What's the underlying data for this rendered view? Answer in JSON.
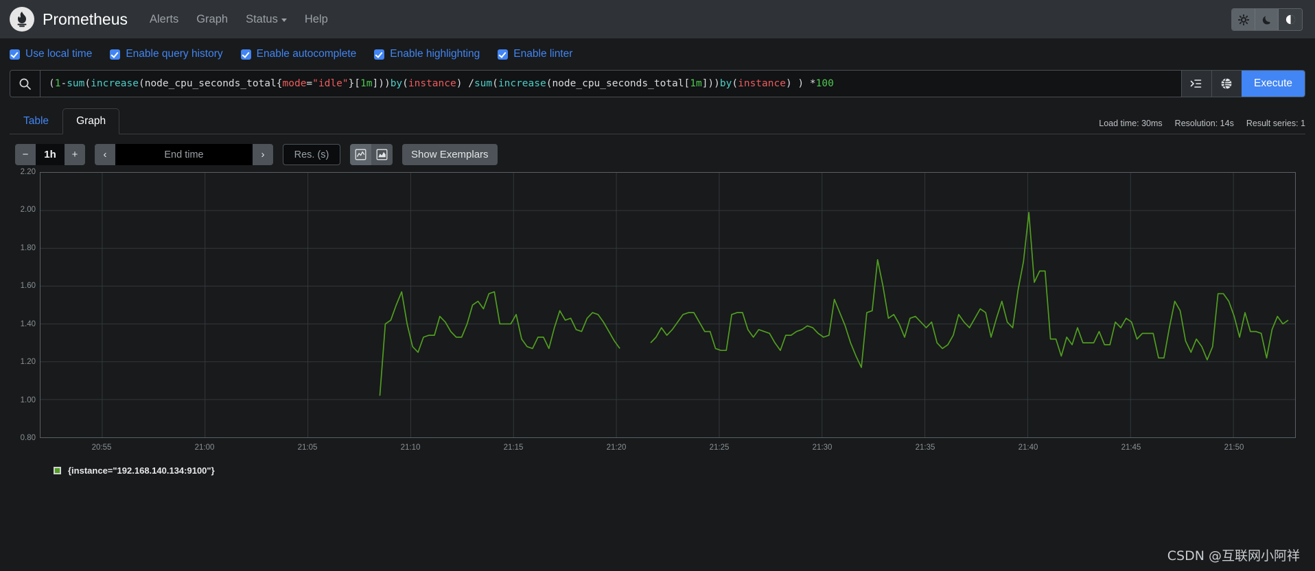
{
  "navbar": {
    "brand": "Prometheus",
    "logo_icon": "prometheus-torch-icon",
    "links": [
      {
        "label": "Alerts",
        "caret": false
      },
      {
        "label": "Graph",
        "caret": false
      },
      {
        "label": "Status",
        "caret": true
      },
      {
        "label": "Help",
        "caret": false
      }
    ],
    "theme_buttons": [
      {
        "icon": "sun-icon",
        "name": "theme-light"
      },
      {
        "icon": "moon-icon",
        "name": "theme-dark"
      },
      {
        "icon": "half-circle-icon",
        "name": "theme-auto"
      }
    ]
  },
  "options": [
    {
      "label": "Use local time",
      "checked": true
    },
    {
      "label": "Enable query history",
      "checked": true
    },
    {
      "label": "Enable autocomplete",
      "checked": true
    },
    {
      "label": "Enable highlighting",
      "checked": true
    },
    {
      "label": "Enable linter",
      "checked": true
    }
  ],
  "query": {
    "search_icon": "search-icon",
    "expression": "(1 - sum(increase(node_cpu_seconds_total{mode=\"idle\"}[1m])) by (instance) / sum(increase(node_cpu_seconds_total[1m])) by (instance) ) * 100",
    "tokens": [
      {
        "t": "(",
        "k": "plain"
      },
      {
        "t": "1",
        "k": "num"
      },
      {
        "t": " - ",
        "k": "plain"
      },
      {
        "t": "sum",
        "k": "fn"
      },
      {
        "t": "(",
        "k": "plain"
      },
      {
        "t": "increase",
        "k": "fn"
      },
      {
        "t": "(node_cpu_seconds_total{",
        "k": "plain"
      },
      {
        "t": "mode",
        "k": "lbl"
      },
      {
        "t": "=",
        "k": "plain"
      },
      {
        "t": "\"idle\"",
        "k": "lbl"
      },
      {
        "t": "}[",
        "k": "plain"
      },
      {
        "t": "1m",
        "k": "num"
      },
      {
        "t": "])) ",
        "k": "plain"
      },
      {
        "t": "by",
        "k": "kw"
      },
      {
        "t": " (",
        "k": "plain"
      },
      {
        "t": "instance",
        "k": "lbl"
      },
      {
        "t": ") / ",
        "k": "plain"
      },
      {
        "t": "sum",
        "k": "fn"
      },
      {
        "t": "(",
        "k": "plain"
      },
      {
        "t": "increase",
        "k": "fn"
      },
      {
        "t": "(node_cpu_seconds_total[",
        "k": "plain"
      },
      {
        "t": "1m",
        "k": "num"
      },
      {
        "t": "])) ",
        "k": "plain"
      },
      {
        "t": "by",
        "k": "kw"
      },
      {
        "t": " (",
        "k": "plain"
      },
      {
        "t": "instance",
        "k": "lbl"
      },
      {
        "t": ") ) * ",
        "k": "plain"
      },
      {
        "t": "100",
        "k": "num"
      }
    ],
    "metric_explorer_icon": "metric-explorer-icon",
    "globe_icon": "globe-icon",
    "execute_label": "Execute",
    "accent_color": "#4285f4"
  },
  "tabs": [
    {
      "label": "Table",
      "active": false
    },
    {
      "label": "Graph",
      "active": true
    }
  ],
  "stats": {
    "load_time": "Load time: 30ms",
    "resolution": "Resolution: 14s",
    "result_series": "Result series: 1"
  },
  "controls": {
    "range_minus": "−",
    "range_value": "1h",
    "range_plus": "+",
    "prev_arrow": "‹",
    "end_time_placeholder": "End time",
    "end_time_value": "",
    "next_arrow": "›",
    "res_placeholder": "Res. (s)",
    "res_value": "",
    "chart_type_line_icon": "line-chart-icon",
    "chart_type_stacked_icon": "stacked-chart-icon",
    "show_exemplars": "Show Exemplars"
  },
  "legend": [
    {
      "label": "{instance=\"192.168.140.134:9100\"}",
      "color": "#509e20"
    }
  ],
  "watermark": "CSDN @互联网小阿祥",
  "chart_data": {
    "type": "line",
    "title": "",
    "xlabel": "",
    "ylabel": "",
    "ylim": [
      0.8,
      2.2
    ],
    "yticks": [
      2.2,
      2.0,
      1.8,
      1.6,
      1.4,
      1.2,
      1.0,
      0.8
    ],
    "ytick_labels": [
      "2.20",
      "2.00",
      "1.80",
      "1.60",
      "1.40",
      "1.20",
      "1.00",
      "0.80"
    ],
    "xticks": [
      "20:55",
      "21:00",
      "21:05",
      "21:10",
      "21:15",
      "21:20",
      "21:25",
      "21:30",
      "21:35",
      "21:40",
      "21:45",
      "21:50"
    ],
    "xlim": [
      "20:52",
      "21:53"
    ],
    "grid": true,
    "legend_position": "bottom-left",
    "line_color": "#509e20",
    "line_width": 1.7,
    "series": [
      {
        "name": "{instance=\"192.168.140.134:9100\"}",
        "segments": [
          {
            "t_start": "21:08:30",
            "t_end": "21:20:10",
            "points": [
              1.02,
              1.4,
              1.42,
              1.5,
              1.57,
              1.4,
              1.28,
              1.25,
              1.33,
              1.34,
              1.34,
              1.44,
              1.41,
              1.36,
              1.33,
              1.33,
              1.4,
              1.5,
              1.52,
              1.48,
              1.56,
              1.57,
              1.4,
              1.4,
              1.4,
              1.45,
              1.32,
              1.28,
              1.27,
              1.33,
              1.33,
              1.27,
              1.38,
              1.47,
              1.42,
              1.43,
              1.37,
              1.36,
              1.43,
              1.46,
              1.45,
              1.41,
              1.36,
              1.31,
              1.27
            ]
          },
          {
            "t_start": "21:21:40",
            "t_end": "21:52:40",
            "points": [
              1.3,
              1.33,
              1.38,
              1.34,
              1.37,
              1.41,
              1.45,
              1.46,
              1.46,
              1.41,
              1.36,
              1.36,
              1.27,
              1.26,
              1.26,
              1.45,
              1.46,
              1.46,
              1.37,
              1.33,
              1.37,
              1.36,
              1.35,
              1.3,
              1.26,
              1.34,
              1.34,
              1.36,
              1.37,
              1.39,
              1.38,
              1.35,
              1.33,
              1.34,
              1.53,
              1.46,
              1.39,
              1.3,
              1.23,
              1.17,
              1.46,
              1.47,
              1.74,
              1.6,
              1.43,
              1.45,
              1.4,
              1.33,
              1.43,
              1.44,
              1.41,
              1.38,
              1.41,
              1.3,
              1.27,
              1.29,
              1.34,
              1.45,
              1.41,
              1.38,
              1.43,
              1.48,
              1.46,
              1.33,
              1.43,
              1.52,
              1.41,
              1.38,
              1.58,
              1.73,
              1.99,
              1.62,
              1.68,
              1.68,
              1.32,
              1.32,
              1.23,
              1.33,
              1.29,
              1.38,
              1.3,
              1.3,
              1.3,
              1.36,
              1.29,
              1.29,
              1.41,
              1.38,
              1.43,
              1.41,
              1.32,
              1.35,
              1.35,
              1.35,
              1.22,
              1.22,
              1.38,
              1.52,
              1.47,
              1.31,
              1.25,
              1.32,
              1.28,
              1.21,
              1.28,
              1.56,
              1.56,
              1.52,
              1.44,
              1.33,
              1.46,
              1.36,
              1.36,
              1.35,
              1.22,
              1.37,
              1.44,
              1.4,
              1.42
            ]
          }
        ]
      }
    ]
  }
}
